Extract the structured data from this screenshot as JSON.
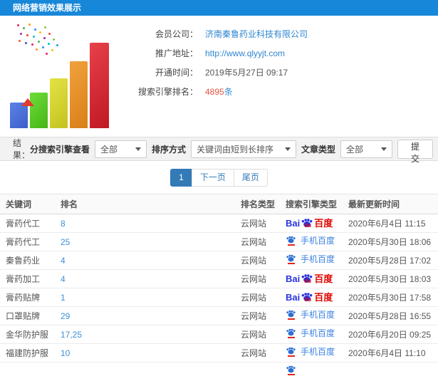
{
  "header": {
    "title": "网络营销效果展示"
  },
  "info": {
    "fields": [
      {
        "label": "会员公司：",
        "value": "济南秦鲁药业科技有限公司"
      },
      {
        "label": "推广地址：",
        "value": "http://www.qlyyjt.com"
      },
      {
        "label": "开通时间：",
        "value": "2019年5月27日 09:17"
      },
      {
        "label": "搜索引擎排名：",
        "value": "4895",
        "suffix": "条"
      }
    ]
  },
  "filters": {
    "result_label": "结果：",
    "engine_label": "分搜索引擎查看",
    "engine_value": "全部",
    "sort_label": "排序方式",
    "sort_value": "关键词由短到长排序",
    "article_label": "文章类型",
    "article_value": "全部",
    "submit_label": "提交"
  },
  "pagination": {
    "current": "1",
    "next": "下一页",
    "last": "尾页"
  },
  "table": {
    "headers": [
      "关键词",
      "排名",
      "排名类型",
      "搜索引擎类型",
      "最新更新时间"
    ],
    "rows": [
      {
        "keyword": "膏药代工",
        "rank": "8",
        "rank_type": "云网站",
        "engine": "百度",
        "updated": "2020年6月4日 11:15"
      },
      {
        "keyword": "膏药代工",
        "rank": "25",
        "rank_type": "云网站",
        "engine": "手机百度",
        "updated": "2020年5月30日 18:06"
      },
      {
        "keyword": "秦鲁药业",
        "rank": "4",
        "rank_type": "云网站",
        "engine": "手机百度",
        "updated": "2020年5月28日 17:02"
      },
      {
        "keyword": "膏药加工",
        "rank": "4",
        "rank_type": "云网站",
        "engine": "百度",
        "updated": "2020年5月30日 18:03"
      },
      {
        "keyword": "膏药贴牌",
        "rank": "1",
        "rank_type": "云网站",
        "engine": "百度",
        "updated": "2020年5月30日 17:58"
      },
      {
        "keyword": "口罩贴牌",
        "rank": "29",
        "rank_type": "云网站",
        "engine": "手机百度",
        "updated": "2020年5月28日 16:55"
      },
      {
        "keyword": "金华防护服",
        "rank": "17,25",
        "rank_type": "云网站",
        "engine": "手机百度",
        "updated": "2020年6月20日 09:25"
      },
      {
        "keyword": "福建防护服",
        "rank": "10",
        "rank_type": "云网站",
        "engine": "手机百度",
        "updated": "2020年6月4日 11:10"
      }
    ]
  },
  "logos": {
    "baidu": {
      "latin_prefix": "Bai",
      "du": "du",
      "cn": "百度"
    },
    "mobile_baidu": {
      "label": "手机百度"
    }
  },
  "colors": {
    "accent_blue": "#1787d9",
    "link_blue": "#2e86d0",
    "rank_link_blue": "#3d8fd8",
    "count_red": "#e8543f",
    "baidu_blue": "#2932e1",
    "baidu_red": "#e10602",
    "pagination_blue": "#337ab7",
    "filter_bar_bg": "#f2f2f2"
  }
}
